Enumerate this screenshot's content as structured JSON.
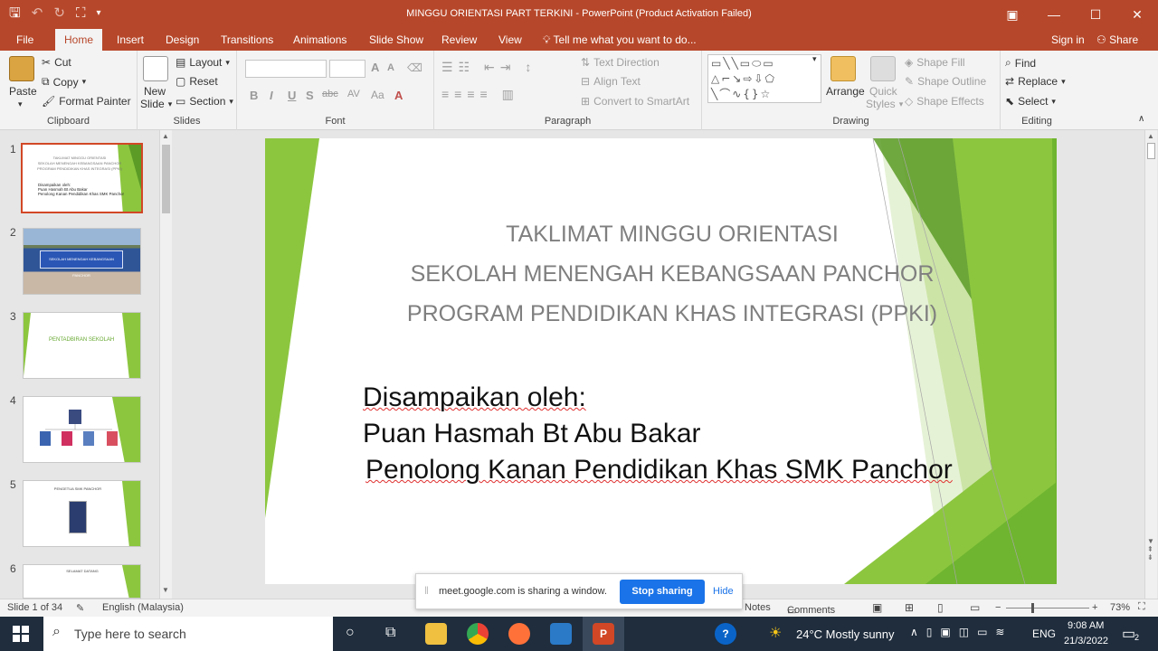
{
  "window": {
    "title": "MINGGU ORIENTASI PART TERKINI - PowerPoint (Product Activation Failed)",
    "controls": [
      "▣",
      "—",
      "☐",
      "✕"
    ]
  },
  "tabs": [
    "File",
    "Home",
    "Insert",
    "Design",
    "Transitions",
    "Animations",
    "Slide Show",
    "Review",
    "View"
  ],
  "tell_me": "Tell me what you want to do...",
  "sign_in": "Sign in",
  "share": "Share",
  "ribbon": {
    "clipboard": {
      "paste": "Paste",
      "cut": "Cut",
      "copy": "Copy",
      "format_painter": "Format Painter",
      "label": "Clipboard"
    },
    "slides": {
      "new_slide_1": "New",
      "new_slide_2": "Slide",
      "layout": "Layout",
      "reset": "Reset",
      "section": "Section",
      "label": "Slides"
    },
    "font": {
      "bold": "B",
      "italic": "I",
      "underline": "U",
      "shadow": "S",
      "strike": "abc",
      "spacing": "AV",
      "case": "Aa",
      "grow": "A",
      "shrink": "A",
      "label": "Font"
    },
    "paragraph": {
      "text_direction": "Text Direction",
      "align_text": "Align Text",
      "convert_smartart": "Convert to SmartArt",
      "label": "Paragraph"
    },
    "drawing": {
      "arrange": "Arrange",
      "quick_1": "Quick",
      "quick_2": "Styles",
      "shape_fill": "Shape Fill",
      "shape_outline": "Shape Outline",
      "shape_effects": "Shape Effects",
      "label": "Drawing",
      "shape_glyphs": "▭╲╲▭⬭▭\n△⌐↘⇨⇩⬠\n╲⌒∿{}☆"
    },
    "editing": {
      "find": "Find",
      "replace": "Replace",
      "select": "Select",
      "label": "Editing"
    }
  },
  "thumbnails": [
    {
      "num": "1",
      "title_lines": [
        "TAKLIMAT MINGGU ORIENTASI",
        "SEKOLAH MENENGAH KEBANGSAAN PANCHOR",
        "PROGRAM PENDIDIKAN KHAS INTEGRASI (PPKI)"
      ],
      "sub_lines": [
        "Disampaikan oleh:",
        "Puan Hasmah Bt Abu Bakar",
        "Penolong Kanan Pendidikan Khas SMK Panchor"
      ]
    },
    {
      "num": "2",
      "sign_text": "SEKOLAH MENENGAH KEBANGSAAN PANCHOR"
    },
    {
      "num": "3",
      "text": "PENTADBIRAN SEKOLAH"
    },
    {
      "num": "4"
    },
    {
      "num": "5",
      "text": "PENGETUA SMK PANCHOR"
    },
    {
      "num": "6",
      "text": "SELAMAT DATANG"
    }
  ],
  "slide": {
    "title_lines": [
      "TAKLIMAT MINGGU ORIENTASI",
      "SEKOLAH MENENGAH KEBANGSAAN PANCHOR",
      "PROGRAM PENDIDIKAN KHAS INTEGRASI (PPKI)"
    ],
    "presenter_label": "Disampaikan oleh:",
    "presenter_name": "Puan Hasmah Bt Abu Bakar",
    "presenter_role": "Penolong Kanan Pendidikan Khas SMK Panchor"
  },
  "status": {
    "slide_count": "Slide 1 of 34",
    "language": "English (Malaysia)",
    "notes": "Notes",
    "comments": "Comments",
    "zoom": "73%",
    "minus": "−",
    "plus": "+"
  },
  "share_banner": {
    "message": "meet.google.com is sharing a window.",
    "stop": "Stop sharing",
    "hide": "Hide"
  },
  "taskbar": {
    "search_placeholder": "Type here to search",
    "weather": "24°C  Mostly sunny",
    "lang": "ENG",
    "time": "9:08 AM",
    "date": "21/3/2022",
    "notif_count": "2"
  },
  "colors": {
    "accent": "#b7472a",
    "green_dark": "#5b9b26",
    "green_light": "#8cc63f",
    "share_blue": "#1a73e8"
  }
}
